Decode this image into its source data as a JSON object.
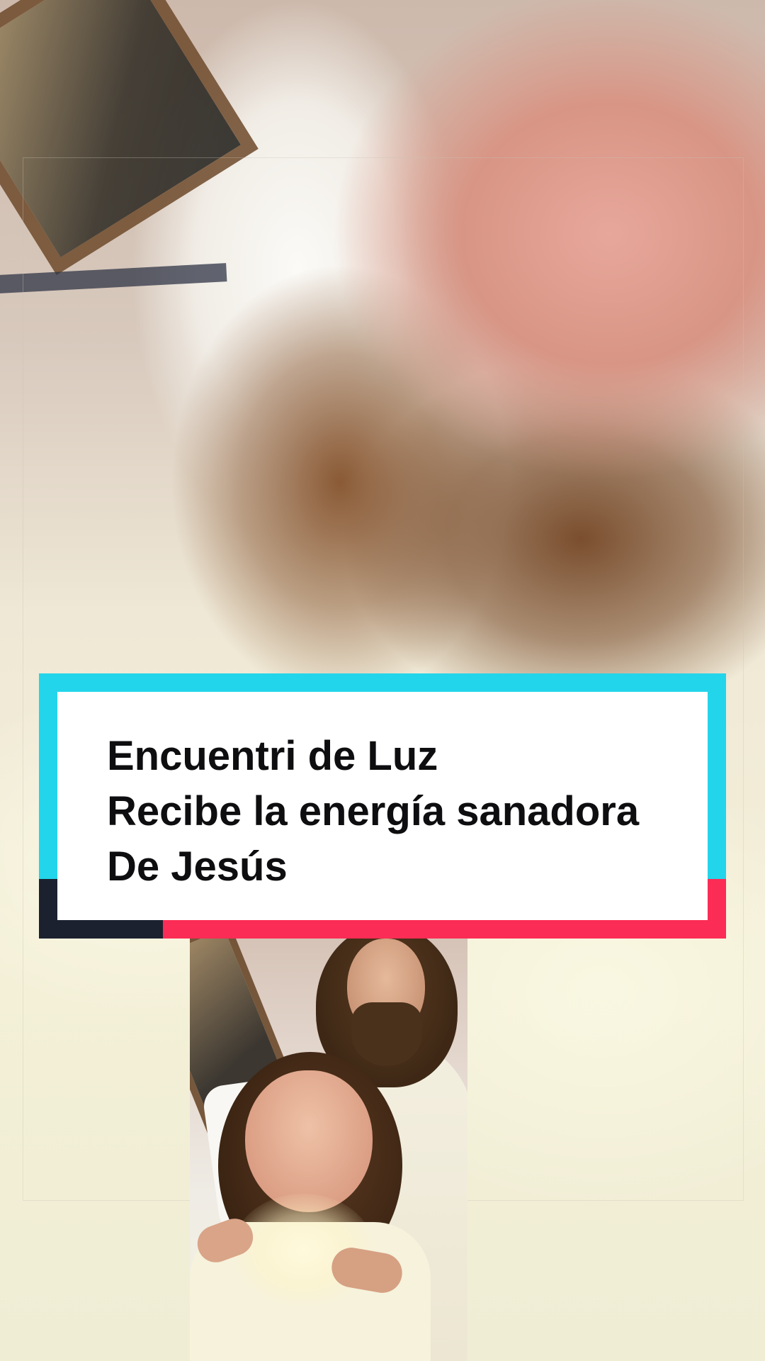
{
  "title_card": {
    "lines": [
      "Encuentri de Luz",
      "Recibe la energía sanadora",
      "De Jesús"
    ]
  },
  "colors": {
    "accent_cyan": "#23d5ea",
    "accent_pink": "#fb2c55",
    "accent_dark": "#1c2130",
    "card_background": "#ffffff",
    "card_text": "#0e0e10"
  },
  "media": {
    "background": "blurred-photo-woman-resting-in-bed",
    "inset": "photo-man-in-white-robe-with-hands-over-resting-woman"
  }
}
